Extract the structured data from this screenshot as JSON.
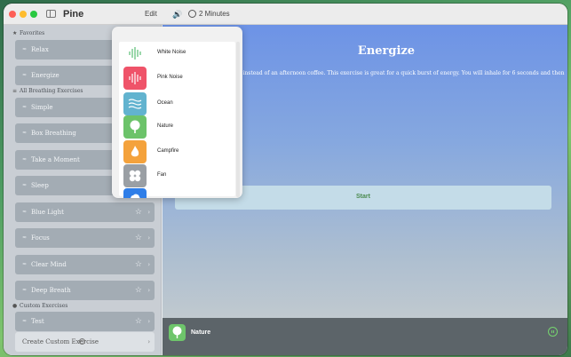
{
  "app": {
    "title": "Pine",
    "edit_label": "Edit",
    "timer_label": "2 Minutes"
  },
  "sidebar": {
    "favorites_header": "Favorites",
    "all_header": "All Breathing Exercises",
    "custom_header": "Custom Exercises",
    "favorites": [
      {
        "label": "Relax"
      },
      {
        "label": "Energize"
      }
    ],
    "exercises": [
      {
        "label": "Simple",
        "starred": false
      },
      {
        "label": "Box Breathing",
        "starred": false
      },
      {
        "label": "Take a Moment",
        "starred": false
      },
      {
        "label": "Sleep",
        "starred": false
      },
      {
        "label": "Blue Light",
        "starred": true
      },
      {
        "label": "Focus",
        "starred": true
      },
      {
        "label": "Clear Mind",
        "starred": true
      },
      {
        "label": "Deep Breath",
        "starred": true
      }
    ],
    "custom": [
      {
        "label": "Test"
      }
    ],
    "create_label": "Create Custom Exercise"
  },
  "main": {
    "title": "Energize",
    "description": "ise instead of an afternoon coffee. This exercise is great for a quick burst of energy. You will inhale for 6 seconds and then",
    "start_label": "Start"
  },
  "player": {
    "sound_name": "Nature",
    "icon": "tree-icon"
  },
  "sounds": [
    {
      "name": "White Noise",
      "icon": "waveform-icon",
      "color": "#ffffff"
    },
    {
      "name": "Pink Noise",
      "icon": "waveform-icon",
      "color": "#ef5369"
    },
    {
      "name": "Ocean",
      "icon": "waves-icon",
      "color": "#62b3cf"
    },
    {
      "name": "Nature",
      "icon": "tree-icon",
      "color": "#6cc36a"
    },
    {
      "name": "Campfire",
      "icon": "flame-icon",
      "color": "#f4a23c"
    },
    {
      "name": "Fan",
      "icon": "fan-icon",
      "color": "#9a9fa4"
    },
    {
      "name": "",
      "icon": "cloud-icon",
      "color": "#2f7ee8"
    }
  ]
}
